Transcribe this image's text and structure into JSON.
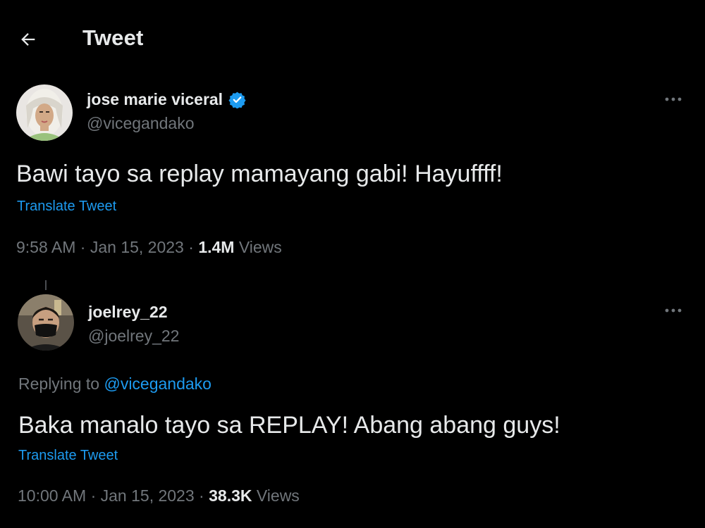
{
  "header": {
    "title": "Tweet"
  },
  "main_tweet": {
    "display_name": "jose marie viceral",
    "handle": "@vicegandako",
    "verified": true,
    "text": "Bawi tayo sa replay mamayang gabi! Hayuffff!",
    "translate_label": "Translate Tweet",
    "time": "9:58 AM",
    "date": "Jan 15, 2023",
    "views_count": "1.4M",
    "views_label": "Views"
  },
  "reply_tweet": {
    "display_name": "joelrey_22",
    "handle": "@joelrey_22",
    "replying_prefix": "Replying to",
    "replying_to": "@vicegandako",
    "text": "Baka manalo tayo sa REPLAY! Abang abang guys!",
    "translate_label": "Translate Tweet",
    "time": "10:00 AM",
    "date": "Jan 15, 2023",
    "views_count": "38.3K",
    "views_label": "Views"
  },
  "colors": {
    "background": "#000000",
    "text_primary": "#e7e9ea",
    "text_secondary": "#71767b",
    "accent": "#1d9bf0"
  },
  "icons": {
    "back": "back-arrow-icon",
    "verified": "verified-badge-icon",
    "more": "more-options-icon"
  }
}
